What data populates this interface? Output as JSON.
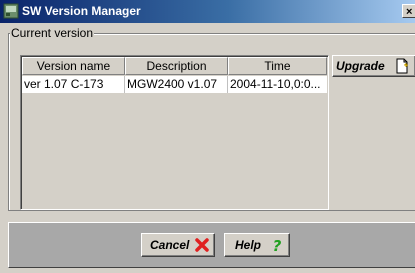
{
  "window": {
    "title": "SW Version Manager",
    "title_icon": "app-icon",
    "close_label": "×"
  },
  "group": {
    "legend": "Current version"
  },
  "table": {
    "headers": [
      "Version name",
      "Description",
      "Time"
    ],
    "rows": [
      [
        "ver 1.07  C-173",
        "MGW2400 v1.07",
        "2004-11-10,0:0..."
      ]
    ]
  },
  "buttons": {
    "upgrade": "Upgrade",
    "upgrade_icon": "new-document-icon",
    "cancel": "Cancel",
    "cancel_icon": "red-x-icon",
    "help": "Help",
    "help_icon": "question-mark-icon"
  },
  "colors": {
    "title_gradient_start": "#0a246a",
    "title_gradient_end": "#a6caf0",
    "panel": "#d4d0c8",
    "bottom_panel": "#a8a8a8",
    "cancel_icon": "#e02020",
    "help_icon": "#20a020"
  }
}
